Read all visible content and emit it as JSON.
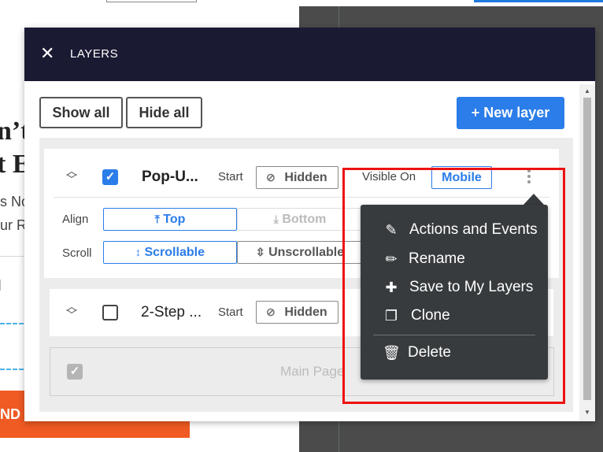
{
  "background": {
    "heading_line1": "n’t",
    "heading_line2": "t E",
    "text_line1": "s No",
    "text_line2": "ur R",
    "orange_button_text": "ND"
  },
  "modal": {
    "title": "LAYERS",
    "close_glyph": "✕"
  },
  "toolbar": {
    "show_all": "Show all",
    "hide_all": "Hide all",
    "new_layer": "+ New layer"
  },
  "layers": [
    {
      "name": "Pop-U...",
      "checked": true,
      "start_label": "Start",
      "start_value": "Hidden",
      "visible_on_label": "Visible On",
      "visible_on_value": "Mobile",
      "align_label": "Align",
      "align_top": "Top",
      "align_bottom": "Bottom",
      "scroll_label": "Scroll",
      "scroll_scrollable": "Scrollable",
      "scroll_unscrollable": "Unscrollable"
    },
    {
      "name": "2-Step ...",
      "checked": false,
      "start_label": "Start",
      "start_value": "Hidden"
    },
    {
      "name": "Main Page",
      "checked": true,
      "disabled": true
    }
  ],
  "context_menu": {
    "items": [
      {
        "label": "Actions and Events",
        "icon": "magic-wand-icon"
      },
      {
        "label": "Rename",
        "icon": "pencil-icon"
      },
      {
        "label": "Save to My Layers",
        "icon": "puzzle-icon"
      },
      {
        "label": "Clone",
        "icon": "copy-icon"
      },
      {
        "label": "Delete",
        "icon": "trash-icon"
      }
    ]
  },
  "colors": {
    "accent": "#2b7de9",
    "header": "#1b1a33",
    "menu_bg": "#373b3e",
    "highlight": "#ee1111"
  }
}
